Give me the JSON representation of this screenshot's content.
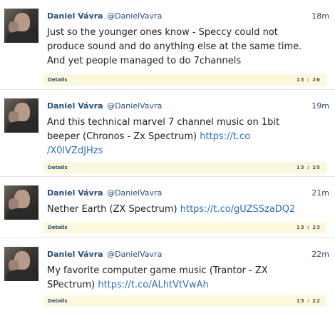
{
  "tweets": [
    {
      "name": "Daniel Vávra",
      "handle": "@DanielVavra",
      "time": "18m",
      "text": "Just so the younger ones know - Speccy could not\nproduce sound and do anything else at the same time.\nAnd yet people managed to do 7channels",
      "link": "",
      "details_label": "Details",
      "details_time": "13 : 26"
    },
    {
      "name": "Daniel Vávra",
      "handle": "@DanielVavra",
      "time": "19m",
      "text": "And this technical marvel 7 channel music on 1bit\nbeeper (Chronos - Zx Spectrum) ",
      "link": "https://t.co\n/X0lVZdJHzs",
      "details_label": "Details",
      "details_time": "13 : 25"
    },
    {
      "name": "Daniel Vávra",
      "handle": "@DanielVavra",
      "time": "21m",
      "text": "Nether Earth (ZX Spectrum) ",
      "link": "https://t.co/gUZSSzaDQ2",
      "details_label": "Details",
      "details_time": "13 : 23"
    },
    {
      "name": "Daniel Vávra",
      "handle": "@DanielVavra",
      "time": "22m",
      "text": "My favorite computer game music (Trantor - ZX\nSPectrum) ",
      "link": "https://t.co/ALhtVtVwAh",
      "details_label": "Details",
      "details_time": "13 : 22"
    }
  ]
}
